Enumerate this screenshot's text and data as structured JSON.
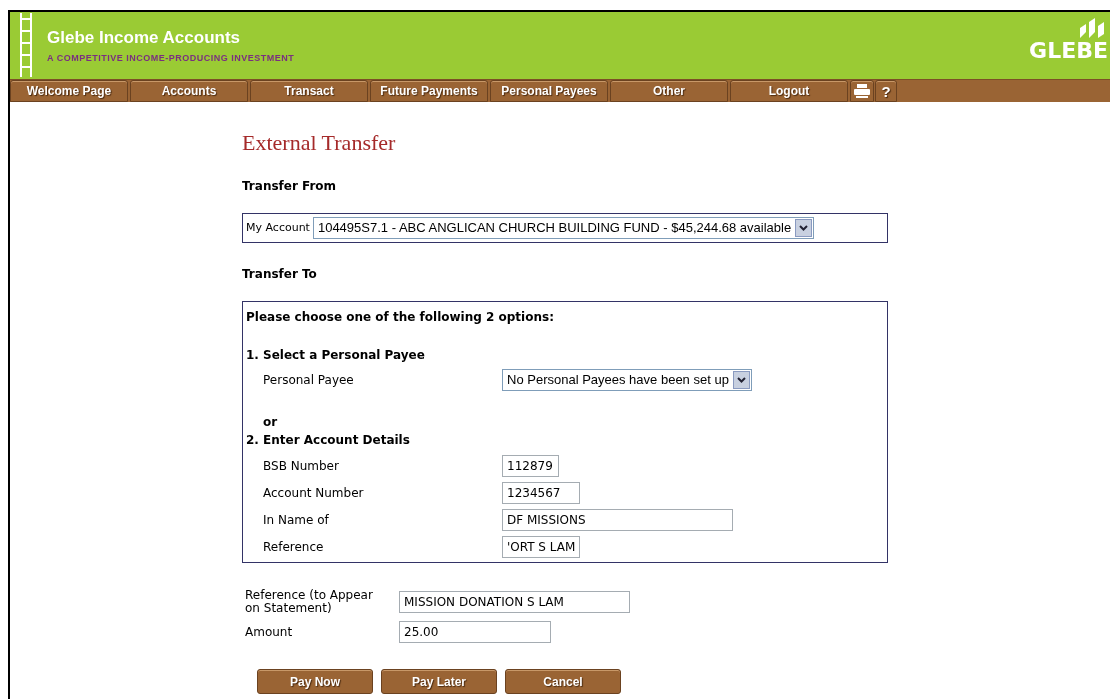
{
  "header": {
    "title": "Glebe Income Accounts",
    "tagline": "A COMPETITIVE INCOME-PRODUCING INVESTMENT",
    "logo_text": "GLEBE"
  },
  "nav": [
    {
      "label": "Welcome Page"
    },
    {
      "label": "Accounts"
    },
    {
      "label": "Transact"
    },
    {
      "label": "Future Payments"
    },
    {
      "label": "Personal Payees"
    },
    {
      "label": "Other"
    },
    {
      "label": "Logout"
    }
  ],
  "tool_buttons": [
    {
      "kind": "print"
    },
    {
      "kind": "text",
      "label": "?"
    }
  ],
  "page_title": "External Transfer",
  "transfer_from": {
    "heading": "Transfer From",
    "label": "My Account",
    "value": "104495S7.1 - ABC ANGLICAN CHURCH BUILDING FUND - $45,244.68 available"
  },
  "transfer_to": {
    "heading": "Transfer To",
    "intro": "Please choose one of the following 2 options:",
    "option1": "1. Select a Personal Payee",
    "payee_label": "Personal Payee",
    "payee_value": "No Personal Payees have been set up",
    "or": "or",
    "option2": "2. Enter Account Details",
    "fields": [
      {
        "label": "BSB Number",
        "value": "112879"
      },
      {
        "label": "Account Number",
        "value": "1234567"
      },
      {
        "label": "In Name of",
        "value": "DF MISSIONS"
      },
      {
        "label": "Reference",
        "value": "'ORT S LAM"
      }
    ]
  },
  "bottom_fields": [
    {
      "label": "Reference (to Appear on Statement)",
      "value": "MISSION DONATION S LAM"
    },
    {
      "label": "Amount",
      "value": "25.00"
    }
  ],
  "buttons": [
    "Pay Now",
    "Pay Later",
    "Cancel"
  ]
}
